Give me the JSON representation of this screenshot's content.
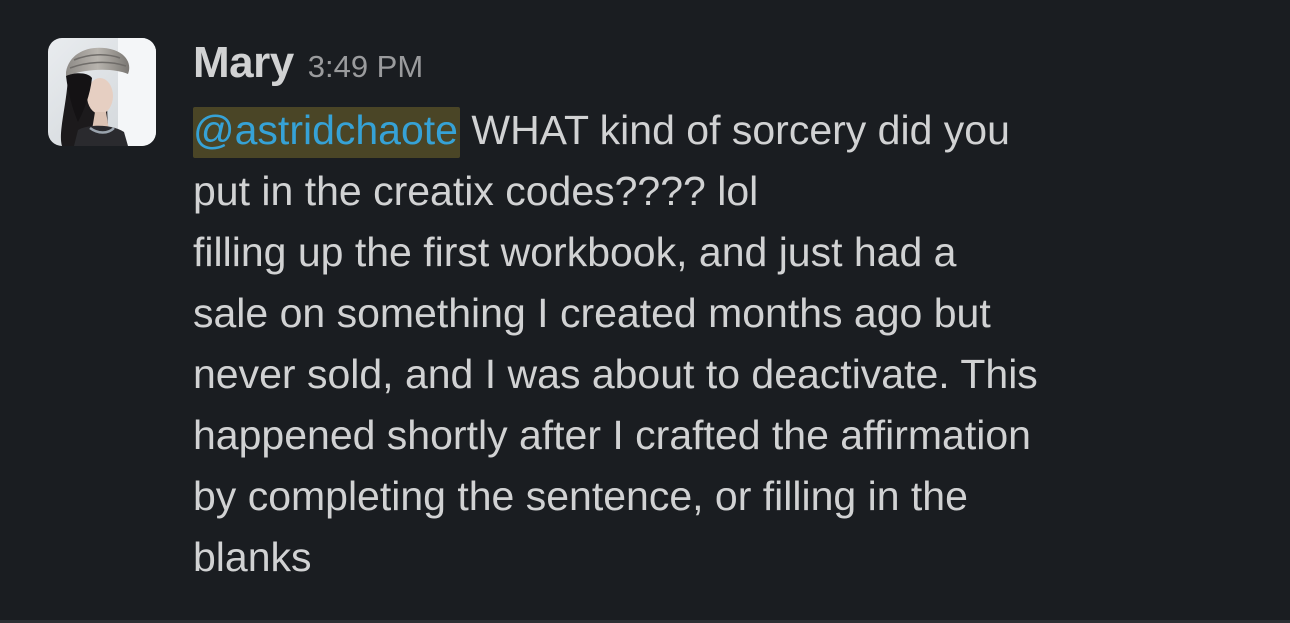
{
  "message": {
    "author": "Mary",
    "timestamp": "3:49 PM",
    "mention": "@astridchaote",
    "lines": [
      " WHAT kind of sorcery did you",
      "put in the creatix codes???? lol",
      "filling up the first workbook, and just had a",
      "sale on something I created months ago but",
      "never sold, and I was about to deactivate. This",
      "happened shortly after I crafted the affirmation",
      "by completing the sentence, or filling in the",
      "blanks"
    ]
  },
  "icons": {
    "avatar": "user-photo-avatar"
  },
  "colors": {
    "background": "#1a1d21",
    "text": "#d1d2d3",
    "timestamp": "#9a9b9d",
    "mention_text": "#36a2d6",
    "mention_highlight": "#4a4526"
  }
}
